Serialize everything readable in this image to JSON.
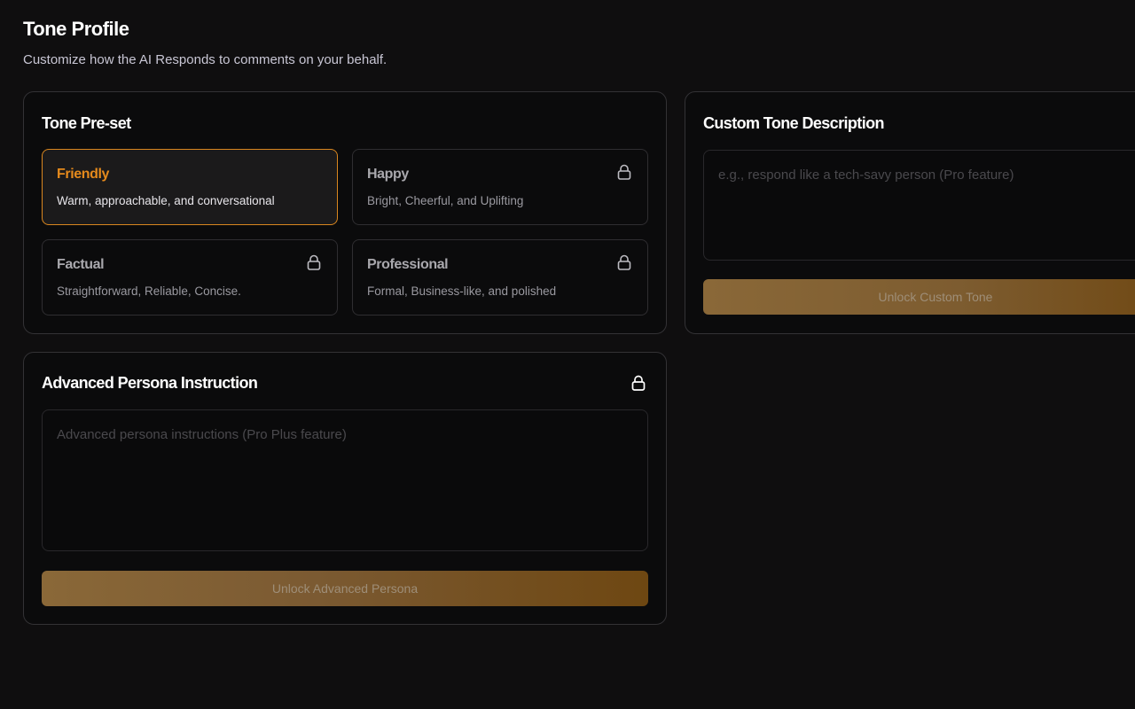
{
  "header": {
    "title": "Tone Profile",
    "subtitle": "Customize how the AI Responds to comments on your behalf."
  },
  "preset": {
    "title": "Tone Pre-set",
    "options": [
      {
        "name": "Friendly",
        "description": "Warm, approachable, and conversational",
        "selected": true,
        "locked": false
      },
      {
        "name": "Happy",
        "description": "Bright, Cheerful, and Uplifting",
        "selected": false,
        "locked": true
      },
      {
        "name": "Factual",
        "description": "Straightforward, Reliable, Concise.",
        "selected": false,
        "locked": true
      },
      {
        "name": "Professional",
        "description": "Formal, Business-like, and polished",
        "selected": false,
        "locked": true
      }
    ]
  },
  "custom": {
    "title": "Custom Tone Description",
    "placeholder": "e.g., respond like a tech-savy person (Pro feature)",
    "value": "",
    "button_label": "Unlock Custom Tone"
  },
  "persona": {
    "title": "Advanced Persona Instruction",
    "placeholder": "Advanced persona instructions (Pro Plus feature)",
    "value": "",
    "button_label": "Unlock Advanced Persona",
    "locked": true
  },
  "colors": {
    "accent": "#e58a1c",
    "background": "#0f0e0f",
    "card": "#0b0b0c",
    "border": "#333235",
    "button_gradient_start": "#8a6838",
    "button_gradient_end": "#6e4712"
  },
  "icons": {
    "lock": "lock-icon"
  }
}
